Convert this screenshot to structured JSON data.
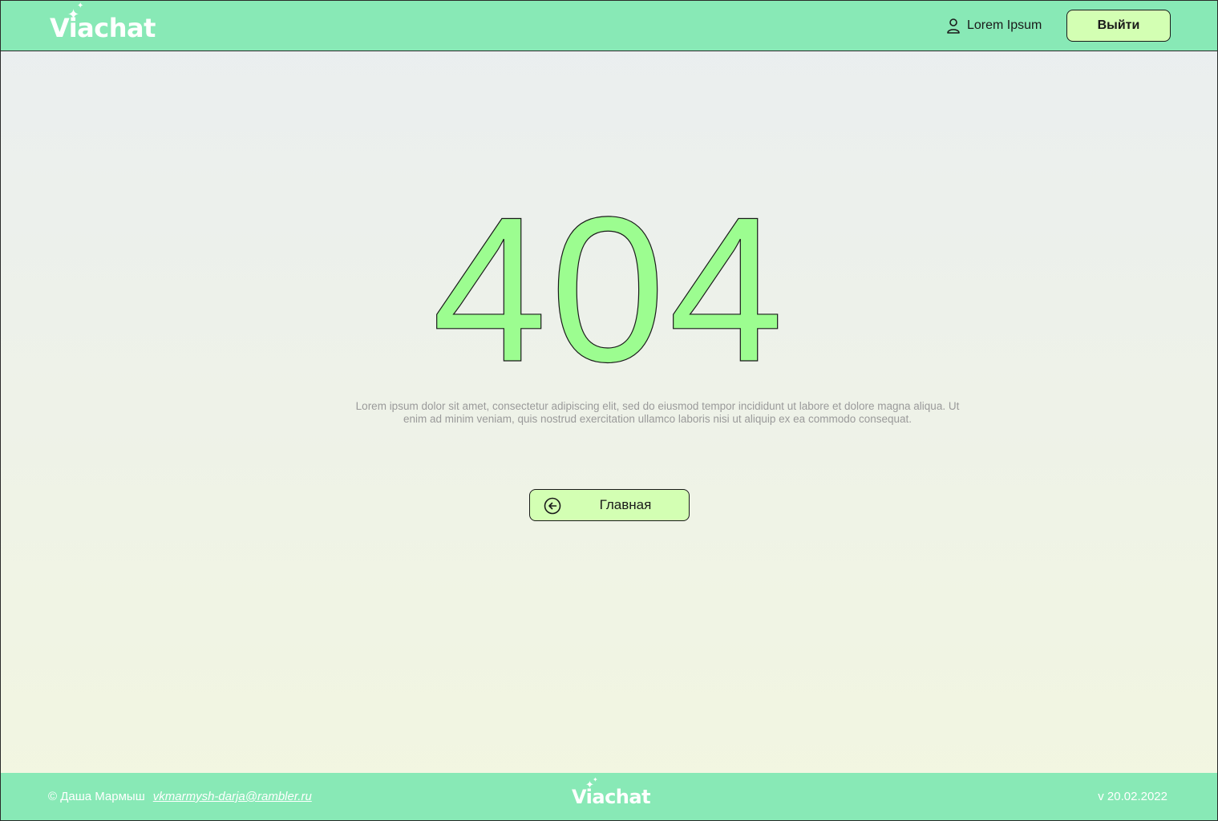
{
  "colors": {
    "header_bg": "#88e9b6",
    "button_bg": "#d3ffb3",
    "digit_fill": "#9cfd90",
    "text_dark": "#1a1a1a",
    "text_muted": "#9a9a9a"
  },
  "header": {
    "logo": "Viachat",
    "user_icon": "user-icon",
    "user_name": "Lorem Ipsum",
    "logout_label": "Выйти"
  },
  "main": {
    "error_code": "404",
    "description": "Lorem ipsum dolor sit amet, consectetur adipiscing elit, sed do eiusmod tempor incididunt ut labore et dolore magna aliqua. Ut enim ad minim veniam, quis nostrud exercitation ullamco laboris nisi ut aliquip ex ea commodo consequat.",
    "home_button_icon": "arrow-left-circle-icon",
    "home_button_label": "Главная"
  },
  "footer": {
    "copyright": "© Даша Мармыш",
    "email": "vkmarmysh-darja@rambler.ru",
    "logo": "Viachat",
    "version": "v 20.02.2022"
  }
}
